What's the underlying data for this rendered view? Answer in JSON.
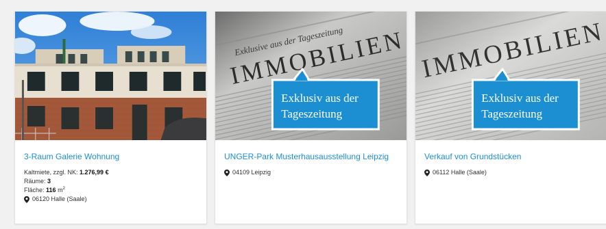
{
  "listings": [
    {
      "title": "3-Raum Galerie Wohnung",
      "image_icon": "building-photo",
      "rent_label": "Kaltmiete, zzgl. NK: ",
      "rent_value": "1.276,99 €",
      "rooms_label": "Räume: ",
      "rooms_value": "3",
      "area_label": "Fläche: ",
      "area_value": "116",
      "area_unit": "m",
      "area_unit_exp": "2",
      "location": "06120 Halle (Saale)"
    },
    {
      "title": "UNGER-Park Musterhausausstellung Leipzig",
      "image_icon": "newspaper-photo",
      "image_top_text": "Exklusive aus der Tageszeitung",
      "image_headline": "IMMOBILIEN",
      "badge_line1": "Exklusiv aus der",
      "badge_line2": "Tageszeitung",
      "location": "04109 Leipzig"
    },
    {
      "title": "Verkauf von Grundstücken",
      "image_icon": "newspaper-photo",
      "image_headline": "IMMOBILIEN",
      "badge_line1": "Exklusiv aus der",
      "badge_line2": "Tageszeitung",
      "location": "06112 Halle (Saale)"
    }
  ],
  "colors": {
    "link": "#1d8ed8",
    "badge": "#1b8fd2",
    "background": "#f1f1f1"
  }
}
